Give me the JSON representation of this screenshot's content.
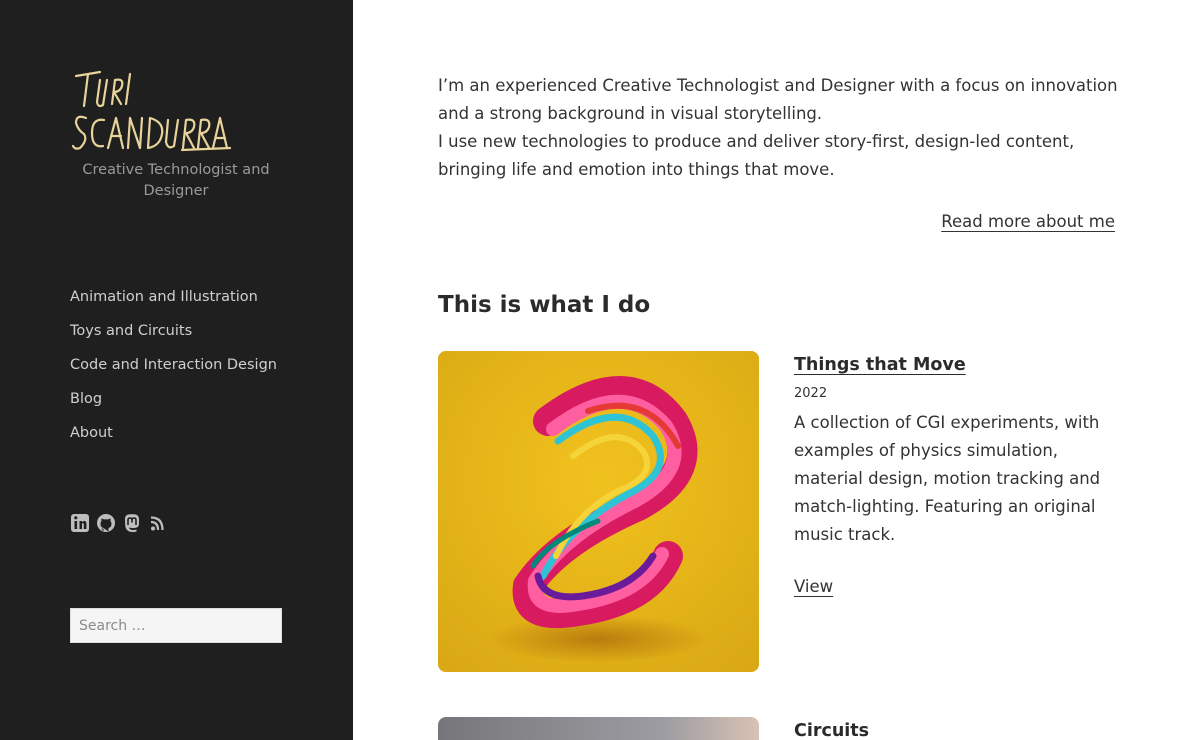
{
  "site": {
    "logo_text": "Turi Scandurra",
    "tagline": "Creative Technologist and Designer"
  },
  "nav": {
    "items": [
      {
        "label": "Animation and Illustration"
      },
      {
        "label": "Toys and Circuits"
      },
      {
        "label": "Code and Interaction Design"
      },
      {
        "label": "Blog"
      },
      {
        "label": "About"
      }
    ]
  },
  "social": {
    "icons": [
      "linkedin-icon",
      "github-icon",
      "mastodon-icon",
      "rss-icon"
    ]
  },
  "search": {
    "placeholder": "Search …"
  },
  "intro": {
    "line1": "I’m an experienced Creative Technologist and Designer with a focus on innovation and a strong background in visual storytelling.",
    "line2": "I use new technologies to produce and deliver story-first, design-led content, bringing life and emotion into things that move.",
    "read_more": "Read more about me"
  },
  "section": {
    "title": "This is what I do"
  },
  "projects": [
    {
      "title": "Things that Move",
      "year": "2022",
      "description": "A collection of CGI experiments, with examples of physics simulation, material design, motion tracking and match-lighting. Featuring an original music track.",
      "view": "View"
    },
    {
      "title": "Circuits"
    }
  ],
  "colors": {
    "sidebar_bg": "#1f1f1f",
    "logo": "#e8d39a",
    "card_bg": "#e0b21a"
  }
}
